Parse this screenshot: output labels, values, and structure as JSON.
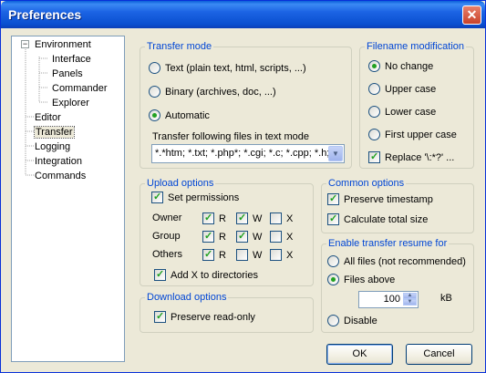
{
  "window": {
    "title": "Preferences"
  },
  "tree": {
    "items": [
      {
        "label": "Environment",
        "level": 0,
        "expanded": true
      },
      {
        "label": "Interface",
        "level": 1
      },
      {
        "label": "Panels",
        "level": 1
      },
      {
        "label": "Commander",
        "level": 1
      },
      {
        "label": "Explorer",
        "level": 1
      },
      {
        "label": "Editor",
        "level": 0
      },
      {
        "label": "Transfer",
        "level": 0,
        "selected": true
      },
      {
        "label": "Logging",
        "level": 0
      },
      {
        "label": "Integration",
        "level": 0
      },
      {
        "label": "Commands",
        "level": 0
      }
    ]
  },
  "transfer_mode": {
    "legend": "Transfer mode",
    "options": [
      {
        "label": "Text (plain text, html, scripts, ...)",
        "checked": false
      },
      {
        "label": "Binary (archives, doc, ...)",
        "checked": false
      },
      {
        "label": "Automatic",
        "checked": true
      }
    ],
    "files_label": "Transfer following files in text mode",
    "files_value": "*.*htm; *.txt; *.php*; *.cgi; *.c; *.cpp; *.h; *.pas;"
  },
  "filename_mod": {
    "legend": "Filename modification",
    "options": [
      {
        "label": "No change",
        "checked": true
      },
      {
        "label": "Upper case",
        "checked": false
      },
      {
        "label": "Lower case",
        "checked": false
      },
      {
        "label": "First upper case",
        "checked": false
      }
    ],
    "replace_label": "Replace '\\:*?' ...",
    "replace_checked": true
  },
  "upload": {
    "legend": "Upload options",
    "set_permissions": "Set permissions",
    "rows": [
      {
        "label": "Owner",
        "r": true,
        "w": true,
        "x": false
      },
      {
        "label": "Group",
        "r": true,
        "w": true,
        "x": false
      },
      {
        "label": "Others",
        "r": true,
        "w": false,
        "x": false
      }
    ],
    "col_r": "R",
    "col_w": "W",
    "col_x": "X",
    "add_x": "Add X to directories"
  },
  "common": {
    "legend": "Common options",
    "preserve_timestamp": "Preserve timestamp",
    "calc_total_size": "Calculate total size"
  },
  "download": {
    "legend": "Download options",
    "preserve_readonly": "Preserve read-only"
  },
  "resume": {
    "legend": "Enable transfer resume for",
    "all_files": "All files (not recommended)",
    "files_above": "Files above",
    "threshold": "100",
    "unit": "kB",
    "disable": "Disable"
  },
  "buttons": {
    "ok": "OK",
    "cancel": "Cancel"
  }
}
